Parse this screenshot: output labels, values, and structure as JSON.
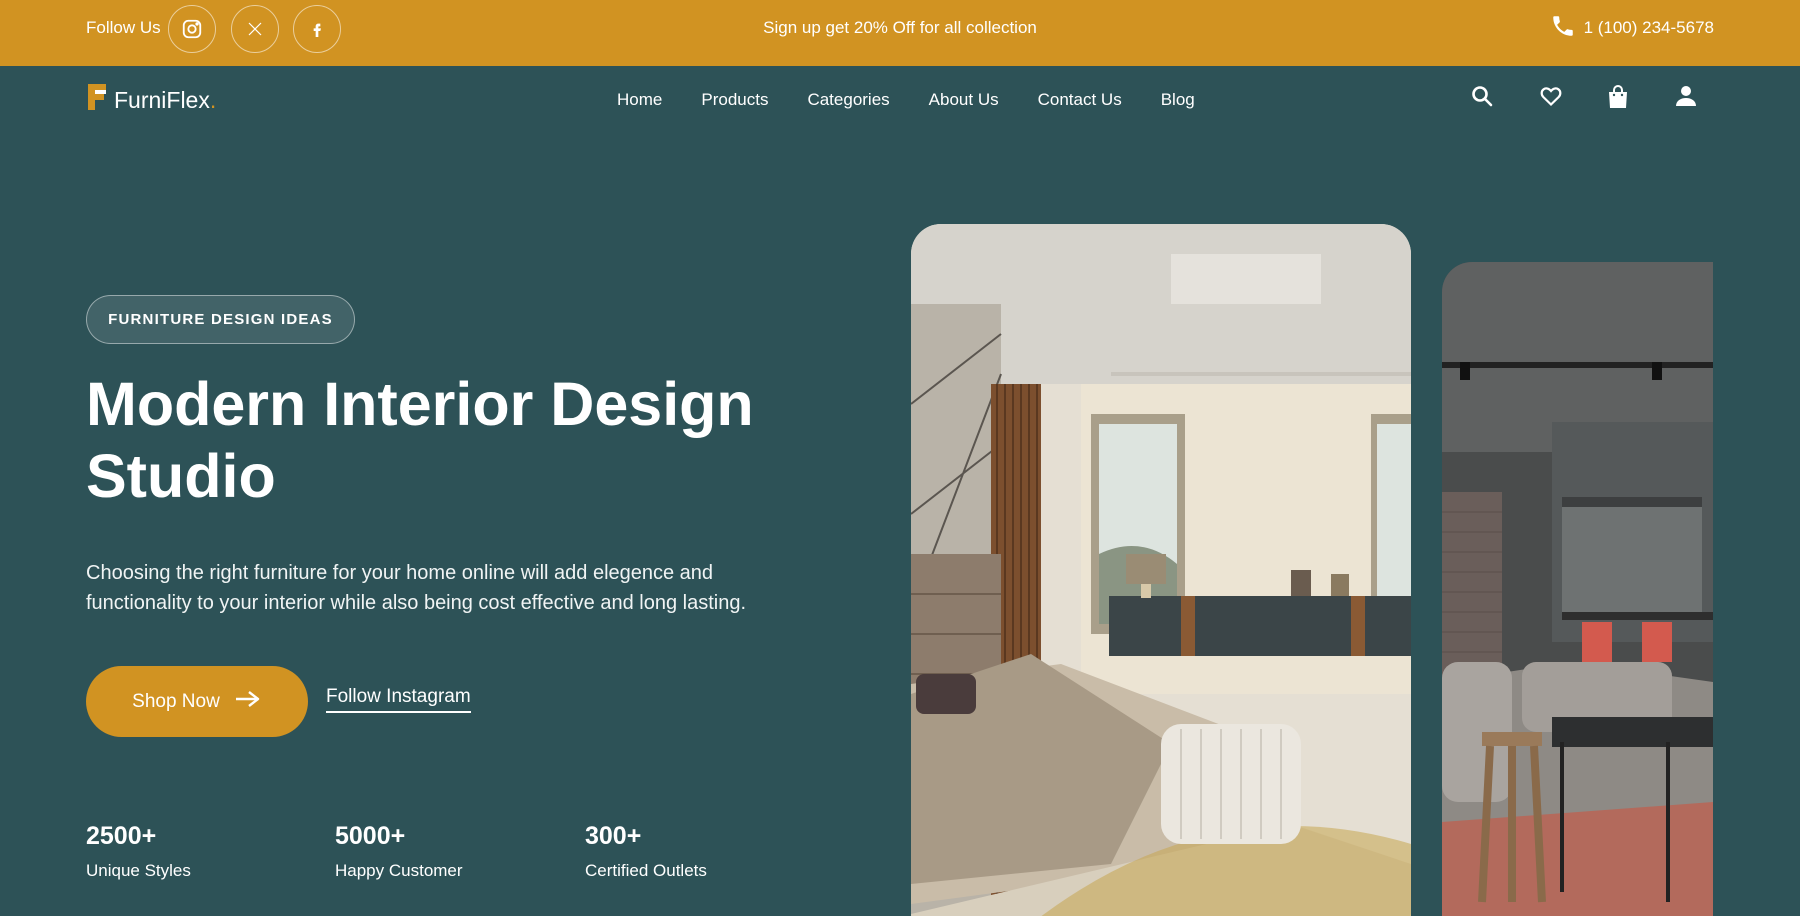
{
  "topbar": {
    "follow_label": "Follow Us",
    "social_icons": [
      "instagram-icon",
      "x-icon",
      "facebook-icon"
    ],
    "promo": "Sign up get 20% Off for all collection",
    "phone": "1 (100) 234-5678"
  },
  "nav": {
    "brand": "FurniFlex",
    "brand_dot": ".",
    "items": [
      "Home",
      "Products",
      "Categories",
      "About Us",
      "Contact Us",
      "Blog"
    ],
    "icons": [
      "search-icon",
      "heart-icon",
      "shopping-bag-icon",
      "user-icon"
    ]
  },
  "hero": {
    "badge": "FURNITURE DESIGN IDEAS",
    "title": "Modern Interior Design Studio",
    "description": "Choosing the right furniture for your home online will add elegence and functionality to your interior while also being cost effective and long lasting.",
    "cta_primary": "Shop Now",
    "cta_secondary": "Follow Instagram"
  },
  "stats": [
    {
      "value": "2500+",
      "label": "Unique Styles"
    },
    {
      "value": "5000+",
      "label": "Happy Customer"
    },
    {
      "value": "300+",
      "label": "Certified Outlets"
    }
  ],
  "colors": {
    "primary_bg": "#2d5257",
    "accent": "#d19322",
    "text": "#ffffff"
  }
}
